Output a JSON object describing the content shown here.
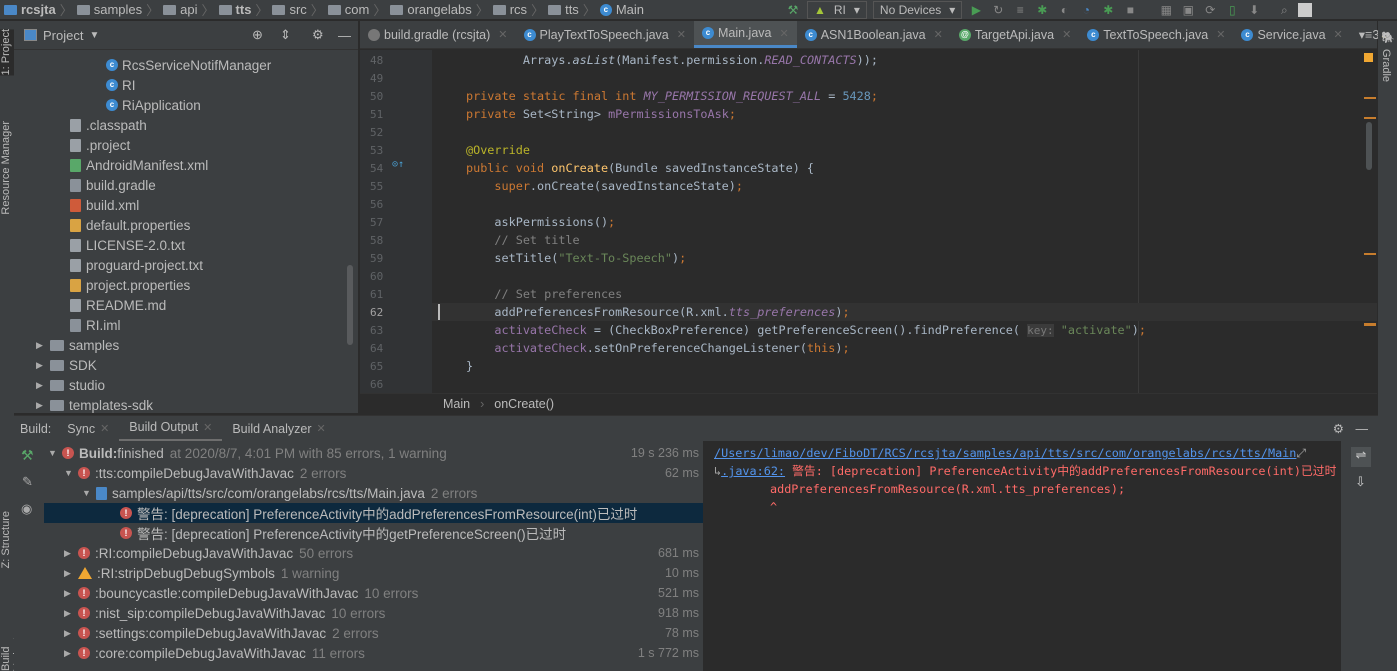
{
  "breadcrumbs": [
    "rcsjta",
    "samples",
    "api",
    "tts",
    "src",
    "com",
    "orangelabs",
    "rcs",
    "tts",
    "Main"
  ],
  "toolbar": {
    "config": "RI",
    "device": "No Devices"
  },
  "left_strip": [
    "1: Project",
    "Resource Manager",
    "Z: Structure",
    "Build Variants"
  ],
  "right_strip": [
    "Gradle"
  ],
  "project": {
    "title": "Project",
    "items": [
      {
        "label": "RcsServiceNotifManager",
        "icon": "class",
        "indent": 3
      },
      {
        "label": "RI",
        "icon": "class",
        "indent": 3
      },
      {
        "label": "RiApplication",
        "icon": "class",
        "indent": 3
      },
      {
        "label": ".classpath",
        "icon": "file",
        "indent": 2
      },
      {
        "label": ".project",
        "icon": "file",
        "indent": 2
      },
      {
        "label": "AndroidManifest.xml",
        "icon": "manifest",
        "indent": 2
      },
      {
        "label": "build.gradle",
        "icon": "gradle",
        "indent": 2
      },
      {
        "label": "build.xml",
        "icon": "xml",
        "indent": 2
      },
      {
        "label": "default.properties",
        "icon": "properties",
        "indent": 2
      },
      {
        "label": "LICENSE-2.0.txt",
        "icon": "file",
        "indent": 2
      },
      {
        "label": "proguard-project.txt",
        "icon": "file",
        "indent": 2
      },
      {
        "label": "project.properties",
        "icon": "properties",
        "indent": 2
      },
      {
        "label": "README.md",
        "icon": "file",
        "indent": 2
      },
      {
        "label": "RI.iml",
        "icon": "module",
        "indent": 2
      },
      {
        "label": "samples",
        "icon": "folder",
        "indent": 1
      },
      {
        "label": "SDK",
        "icon": "folder",
        "indent": 1
      },
      {
        "label": "studio",
        "icon": "folder",
        "indent": 1
      },
      {
        "label": "templates-sdk",
        "icon": "folder",
        "indent": 1
      }
    ]
  },
  "editor_tabs": [
    {
      "label": "build.gradle (rcsjta)",
      "icon": "gradle"
    },
    {
      "label": "PlayTextToSpeech.java",
      "icon": "class"
    },
    {
      "label": "Main.java",
      "icon": "class",
      "active": true
    },
    {
      "label": "ASN1Boolean.java",
      "icon": "class"
    },
    {
      "label": "TargetApi.java",
      "icon": "annotation"
    },
    {
      "label": "TextToSpeech.java",
      "icon": "class"
    },
    {
      "label": "Service.java",
      "icon": "class"
    }
  ],
  "tabs_overflow": "3",
  "code": [
    {
      "n": "48",
      "t": [
        [
          "        Arrays.",
          "d"
        ],
        [
          "asList",
          "it"
        ],
        [
          "(Manifest.permission.",
          "d"
        ],
        [
          "READ_CONTACTS",
          "fi"
        ],
        [
          "));",
          "d"
        ]
      ]
    },
    {
      "n": "49",
      "t": []
    },
    {
      "n": "50",
      "t": [
        [
          "private static final int ",
          "k"
        ],
        [
          "MY_PERMISSION_REQUEST_ALL",
          "fi"
        ],
        [
          " = ",
          "d"
        ],
        [
          "5428",
          "n"
        ],
        [
          ";",
          "k"
        ]
      ]
    },
    {
      "n": "51",
      "t": [
        [
          "private ",
          "k"
        ],
        [
          "Set<String> ",
          "d"
        ],
        [
          "mPermissionsToAsk",
          "f"
        ],
        [
          ";",
          "k"
        ]
      ]
    },
    {
      "n": "52",
      "t": []
    },
    {
      "n": "53",
      "t": [
        [
          "@Override",
          "a"
        ]
      ]
    },
    {
      "n": "54",
      "t": [
        [
          "public void ",
          "k"
        ],
        [
          "onCreate",
          "m"
        ],
        [
          "(Bundle savedInstanceState) {",
          "d"
        ]
      ]
    },
    {
      "n": "55",
      "t": [
        [
          "    super",
          "k"
        ],
        [
          ".onCreate(savedInstanceState)",
          "d"
        ],
        [
          ";",
          "k"
        ]
      ]
    },
    {
      "n": "56",
      "t": []
    },
    {
      "n": "57",
      "t": [
        [
          "    askPermissions()",
          "d"
        ],
        [
          ";",
          "k"
        ]
      ]
    },
    {
      "n": "58",
      "t": [
        [
          "    // Set title",
          "c"
        ]
      ]
    },
    {
      "n": "59",
      "t": [
        [
          "    setTitle(",
          "d"
        ],
        [
          "\"Text-To-Speech\"",
          "s"
        ],
        [
          ")",
          "d"
        ],
        [
          ";",
          "k"
        ]
      ]
    },
    {
      "n": "60",
      "t": []
    },
    {
      "n": "61",
      "t": [
        [
          "    // Set preferences",
          "c"
        ]
      ]
    },
    {
      "n": "62",
      "t": [
        [
          "    addPreferencesFromResource(R.xml.",
          "d"
        ],
        [
          "tts_preferences",
          "fi"
        ],
        [
          ")",
          "d"
        ],
        [
          ";",
          "k"
        ]
      ]
    },
    {
      "n": "63",
      "t": [
        [
          "    ",
          "d"
        ],
        [
          "activateCheck",
          "f"
        ],
        [
          " = (CheckBoxPreference) getPreferenceScreen().findPreference( ",
          "d"
        ],
        [
          "key:",
          "h"
        ],
        [
          " ",
          "d"
        ],
        [
          "\"activate\"",
          "s"
        ],
        [
          ")",
          "d"
        ],
        [
          ";",
          "k"
        ]
      ]
    },
    {
      "n": "64",
      "t": [
        [
          "    ",
          "d"
        ],
        [
          "activateCheck",
          "f"
        ],
        [
          ".setOnPreferenceChangeListener(",
          "d"
        ],
        [
          "this",
          "k"
        ],
        [
          ")",
          "d"
        ],
        [
          ";",
          "k"
        ]
      ]
    },
    {
      "n": "65",
      "t": [
        [
          "}",
          "d"
        ]
      ]
    },
    {
      "n": "66",
      "t": []
    }
  ],
  "current_line": "62",
  "editor_breadcrumb": [
    "Main",
    "onCreate()"
  ],
  "build": {
    "label": "Build:",
    "tabs": [
      {
        "label": "Sync"
      },
      {
        "label": "Build Output",
        "active": true
      },
      {
        "label": "Build Analyzer"
      }
    ],
    "rows": [
      {
        "arrow": "down",
        "icon": "error",
        "bold": "Build:",
        "text": " finished",
        "dim": "at 2020/8/7, 4:01 PM with 85 errors, 1 warning",
        "dur": "19 s 236 ms",
        "indent": 0
      },
      {
        "arrow": "down",
        "icon": "error",
        "text": ":tts:compileDebugJavaWithJavac",
        "dim": "2 errors",
        "dur": "62 ms",
        "indent": 1
      },
      {
        "arrow": "down",
        "icon": "javafile",
        "text": "samples/api/tts/src/com/orangelabs/rcs/tts/Main.java",
        "dim": "2 errors",
        "indent": 2
      },
      {
        "icon": "error",
        "text": "警告: [deprecation] PreferenceActivity中的addPreferencesFromResource(int)已过时",
        "indent": 3,
        "selected": true
      },
      {
        "icon": "error",
        "text": "警告: [deprecation] PreferenceActivity中的getPreferenceScreen()已过时",
        "indent": 3
      },
      {
        "arrow": "right",
        "icon": "error",
        "text": ":RI:compileDebugJavaWithJavac",
        "dim": "50 errors",
        "dur": "681 ms",
        "indent": 1
      },
      {
        "arrow": "right",
        "icon": "warning",
        "text": ":RI:stripDebugDebugSymbols",
        "dim": "1 warning",
        "dur": "10 ms",
        "indent": 1
      },
      {
        "arrow": "right",
        "icon": "error",
        "text": ":bouncycastle:compileDebugJavaWithJavac",
        "dim": "10 errors",
        "dur": "521 ms",
        "indent": 1
      },
      {
        "arrow": "right",
        "icon": "error",
        "text": ":nist_sip:compileDebugJavaWithJavac",
        "dim": "10 errors",
        "dur": "918 ms",
        "indent": 1
      },
      {
        "arrow": "right",
        "icon": "error",
        "text": ":settings:compileDebugJavaWithJavac",
        "dim": "2 errors",
        "dur": "78 ms",
        "indent": 1
      },
      {
        "arrow": "right",
        "icon": "error",
        "text": ":core:compileDebugJavaWithJavac",
        "dim": "11 errors",
        "dur": "1 s 772 ms",
        "indent": 1
      }
    ],
    "console": {
      "path": "/Users/limao/dev/FiboDT/RCS/rcsjta/samples/api/tts/src/com/orangelabs/rcs/tts/Main",
      "path_cont": ".java:62:",
      "message": " 警告: [deprecation] PreferenceActivity中的addPreferencesFromResource(int)已过时",
      "code": "addPreferencesFromResource(R.xml.tts_preferences);",
      "caret": "^"
    }
  },
  "colors": {
    "accent": "#4a88c7",
    "error": "#c75450",
    "warning": "#f0a732",
    "console_error": "#ff6b68"
  }
}
